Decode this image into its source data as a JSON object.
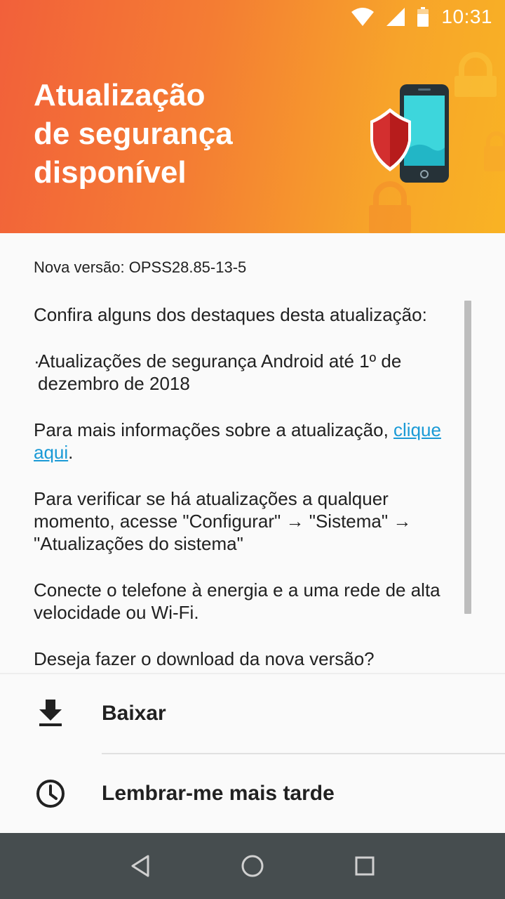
{
  "status_bar": {
    "time": "10:31",
    "icons": [
      "wifi-icon",
      "signal-icon",
      "battery-icon"
    ]
  },
  "header": {
    "title_line1": "Atualização",
    "title_line2": "de segurança",
    "title_line3": "disponível",
    "illustration": "phone-shield-lock-illustration",
    "colors": {
      "gradient_start": "#f2603a",
      "gradient_end": "#f9b324"
    }
  },
  "content": {
    "version": "Nova versão: OPSS28.85-13-5",
    "intro": "Confira alguns dos destaques desta atualização:",
    "bullet": "Atualizações de segurança Android até 1º de dezembro de 2018",
    "more_info_prefix": "Para mais informações sobre a atualização, ",
    "more_info_link": "clique aqui",
    "more_info_suffix": ".",
    "check_updates": "Para verificar se há atualizações a qualquer momento, acesse \"Configurar\" → \"Sistema\" → \"Atualizações do sistema\"",
    "connect": "Conecte o telefone à energia e a uma rede de alta velocidade ou Wi-Fi.",
    "question": "Deseja fazer o download da nova versão?",
    "link_color": "#1a9ad6"
  },
  "actions": {
    "download": {
      "label": "Baixar",
      "icon": "download-icon"
    },
    "remind": {
      "label": "Lembrar-me mais tarde",
      "icon": "clock-icon"
    }
  },
  "nav_bar": {
    "buttons": [
      "back-icon",
      "home-icon",
      "recents-icon"
    ]
  }
}
